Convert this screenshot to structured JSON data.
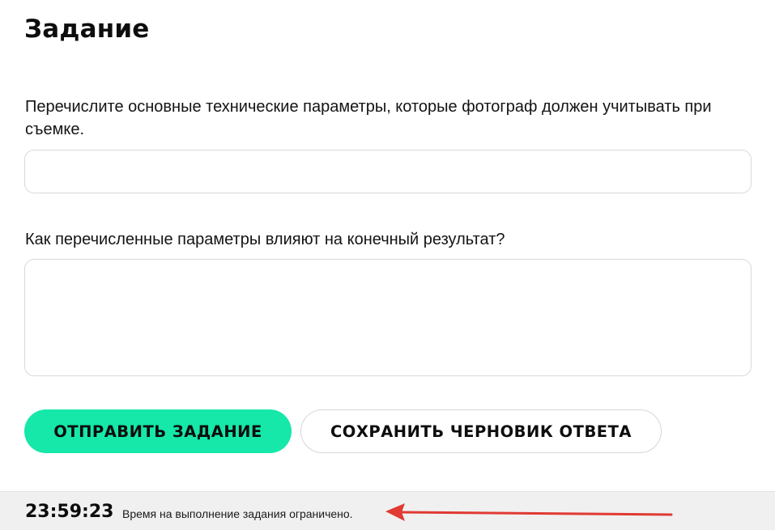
{
  "page": {
    "title": "Задание"
  },
  "questions": [
    {
      "text": "Перечислите основные технические параметры, которые фотограф должен учитывать при съемке.",
      "answer_value": ""
    },
    {
      "text": "Как перечисленные параметры влияют на конечный результат?",
      "answer_value": ""
    }
  ],
  "actions": {
    "submit_label": "ОТПРАВИТЬ ЗАДАНИЕ",
    "save_draft_label": "СОХРАНИТЬ ЧЕРНОВИК ОТВЕТА"
  },
  "footer": {
    "timer": "23:59:23",
    "time_note": "Время на выполнение задания ограничено."
  },
  "colors": {
    "accent": "#15e8a8",
    "annotation_arrow": "#e03a33",
    "footer_bg": "#f0f0f0"
  },
  "icons": {
    "annotation": "arrow-left-icon"
  }
}
